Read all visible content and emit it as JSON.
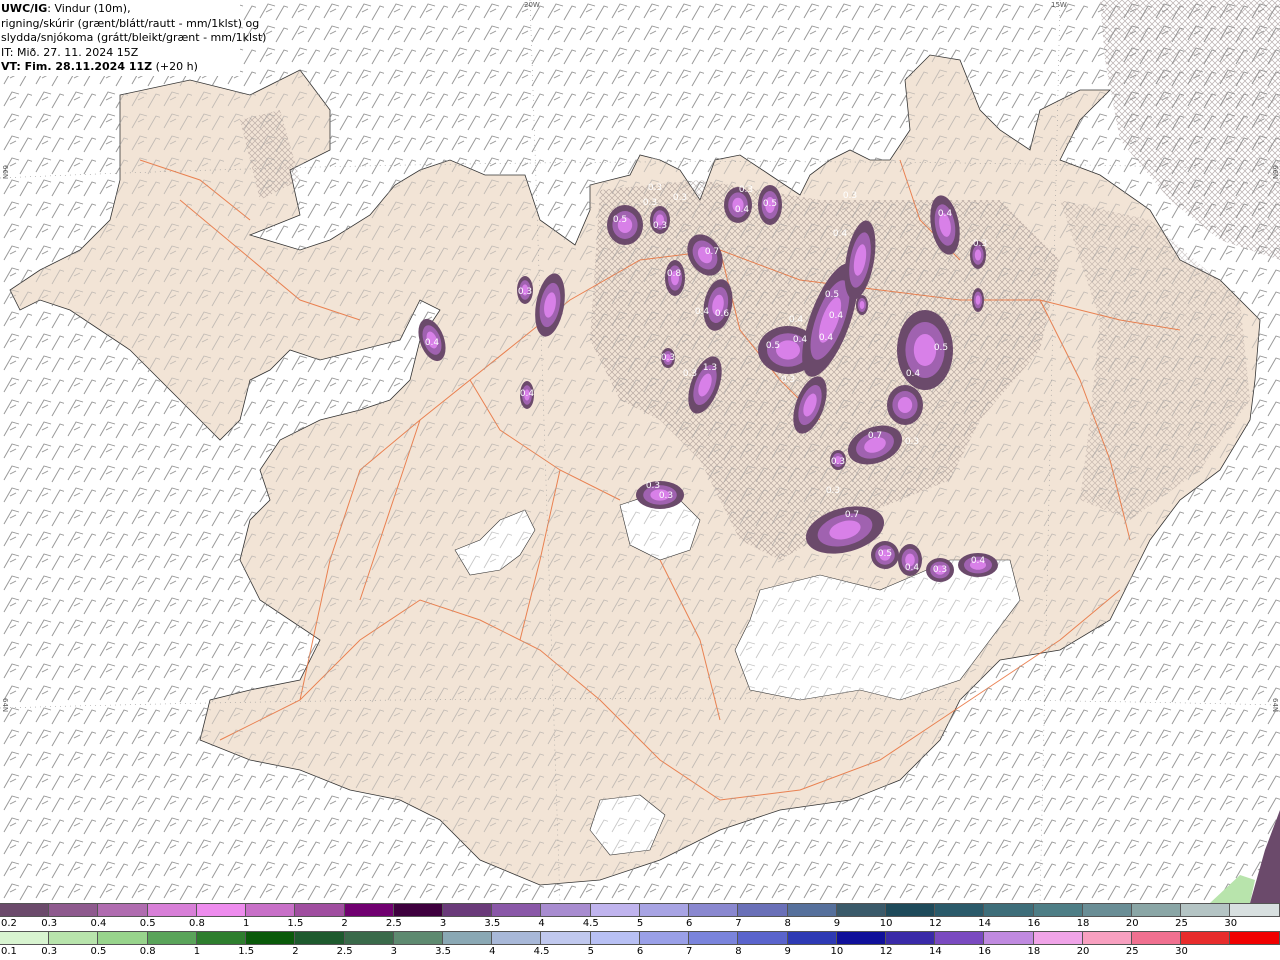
{
  "header": {
    "line1_bold": "UWC/IG",
    "line1_rest": ": Vindur (10m),",
    "line2": "rigning/skúrir (grænt/blátt/rautt - mm/1klst) og",
    "line3": "slydda/snjókoma (grátt/bleikt/grænt - mm/1klst)",
    "line4": "IT: Mið. 27. 11. 2024 15Z",
    "line5_bold": "VT: Fim. 28.11.2024 11Z",
    "line5_rest": " (+20 h)"
  },
  "grid_labels": {
    "top_20w": "20W",
    "top_15w": "15W",
    "left_66n": "66N",
    "left_64n": "64N",
    "right_66n": "66N",
    "right_64n": "64N"
  },
  "precip_labels": [
    "0.3",
    "0.3",
    "0.3",
    "0.5",
    "0.3",
    "0.7",
    "0.8",
    "0.4",
    "0.6",
    "0.3",
    "1.3",
    "0.3",
    "0.4",
    "0.5",
    "0.3",
    "0.3",
    "0.4",
    "0.4",
    "0.3",
    "0.4",
    "0.5",
    "0.4",
    "0.4",
    "0.5",
    "0.4",
    "0.4",
    "0.5",
    "0.4",
    "0.7",
    "0.3",
    "0.3",
    "0.3",
    "0.7",
    "0.5",
    "0.4",
    "0.3",
    "0.4",
    "0.3",
    "0.3",
    "0.3",
    "0.4",
    "0.3"
  ],
  "snow_scale": {
    "labels": [
      "0.2",
      "0.3",
      "0.4",
      "0.5",
      "0.8",
      "1",
      "1.5",
      "2",
      "2.5",
      "3",
      "3.5",
      "4",
      "4.5",
      "5",
      "6",
      "7",
      "8",
      "9",
      "10",
      "12",
      "14",
      "16",
      "18",
      "20",
      "25",
      "30"
    ],
    "colors": [
      "#6b4a6b",
      "#8e5a8e",
      "#b06cb0",
      "#d87fd8",
      "#ee8cee",
      "#c870c8",
      "#a04ea0",
      "#700070",
      "#3e003e",
      "#6a3a7a",
      "#8a58a8",
      "#a88cd0",
      "#c0b4ee",
      "#a8a4e4",
      "#8a88d0",
      "#6a70b8",
      "#56709c",
      "#3a5a6a",
      "#1e4a5a",
      "#2a5a6a",
      "#3e6e7a",
      "#4e7e86",
      "#6a8e96",
      "#8aa6a6",
      "#b4c4c4",
      "#d8e0e0"
    ]
  },
  "rain_scale": {
    "labels": [
      "0.1",
      "0.3",
      "0.5",
      "0.8",
      "1",
      "1.5",
      "2",
      "2.5",
      "3",
      "3.5",
      "4",
      "4.5",
      "5",
      "6",
      "7",
      "8",
      "9",
      "10",
      "12",
      "14",
      "16",
      "18",
      "20",
      "25",
      "30"
    ],
    "colors": [
      "#d8f4d0",
      "#b8e4ac",
      "#98d48c",
      "#5aa45a",
      "#2e7e2e",
      "#0a5a0a",
      "#1e5a2e",
      "#3a6a4a",
      "#5e8a70",
      "#8aa8b4",
      "#a8b8d8",
      "#c0c8ee",
      "#b8c0f4",
      "#9aa0e8",
      "#7a84dc",
      "#5a64cc",
      "#2e3ab4",
      "#10109a",
      "#3a2aa8",
      "#7a4ac0",
      "#c08ae0",
      "#f0a4e8",
      "#f8a0c0",
      "#f07090",
      "#e82c2c",
      "#f00000"
    ]
  },
  "colors": {
    "land": "#f2e4d6",
    "sea": "#ffffff",
    "roads": "#e8703a",
    "precip_outer": "#6b4a6b",
    "precip_mid": "#a062b0",
    "precip_inner": "#d880e8",
    "barb": "#909090",
    "hatch": "#8a7a7a"
  }
}
